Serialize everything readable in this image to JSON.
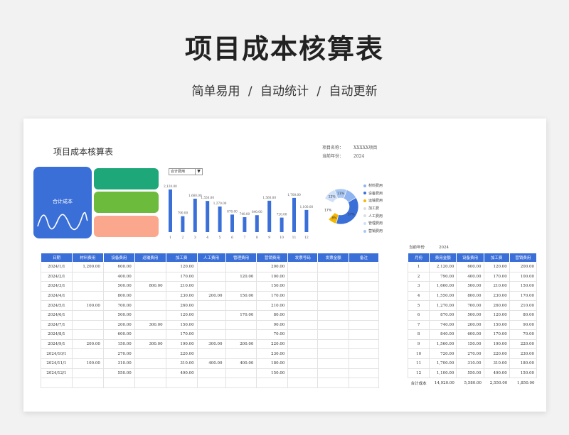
{
  "header": {
    "title": "项目成本核算表",
    "subtitle": "简单易用  /  自动统计  /  自动更新"
  },
  "sheet": {
    "title": "项目成本核算表",
    "project_name_label": "项目名称：",
    "project_name_value": "XXXXX项目",
    "current_year_label": "当前年份：",
    "current_year_value": "2024",
    "card_label": "合计成本",
    "dropdown_value": "合计费用"
  },
  "chart_data": [
    {
      "type": "bar",
      "categories": [
        "1",
        "2",
        "3",
        "4",
        "5",
        "6",
        "7",
        "8",
        "9",
        "10",
        "11",
        "12"
      ],
      "values": [
        2120,
        790,
        1660,
        1550,
        1270,
        870,
        740,
        840,
        1560,
        720,
        1700,
        1100
      ],
      "labels": [
        "2,120.00",
        "790.00",
        "1,660.00",
        "1,550.00",
        "1,270.00",
        "870.00",
        "740.00",
        "840.00",
        "1,560.00",
        "720.00",
        "1,700.00",
        "1,100.00"
      ],
      "color": "#3b6fd8"
    },
    {
      "type": "pie",
      "categories": [
        "材料费用",
        "设备费用",
        "运输费用",
        "加工费",
        "人工费用",
        "管理费用",
        "营销费用"
      ],
      "values": [
        11,
        37,
        8,
        17,
        3,
        12,
        11
      ],
      "labels": [
        "",
        "37%",
        "8%",
        "17%",
        "",
        "12%",
        "11%"
      ],
      "colors": [
        "#8fb4ef",
        "#3b6fd8",
        "#f5b800",
        "#ffffff",
        "#ffffff",
        "#cfe0f8",
        "#a9c7f2"
      ]
    }
  ],
  "cost_table": {
    "headers": [
      "日期",
      "材料费用",
      "设备费用",
      "运输费用",
      "加工费",
      "人工费用",
      "管理费用",
      "营销费用",
      "发票号码",
      "发票金额",
      "备注"
    ],
    "rows": [
      [
        "2024/1/1",
        "1,200.00",
        "600.00",
        "",
        "120.00",
        "",
        "",
        "200.00",
        "",
        "",
        ""
      ],
      [
        "2024/2/1",
        "",
        "400.00",
        "",
        "170.00",
        "",
        "120.00",
        "100.00",
        "",
        "",
        ""
      ],
      [
        "2024/3/1",
        "",
        "500.00",
        "800.00",
        "210.00",
        "",
        "",
        "150.00",
        "",
        "",
        ""
      ],
      [
        "2024/4/1",
        "",
        "800.00",
        "",
        "230.00",
        "200.00",
        "150.00",
        "170.00",
        "",
        "",
        ""
      ],
      [
        "2024/5/1",
        "100.00",
        "700.00",
        "",
        "260.00",
        "",
        "",
        "210.00",
        "",
        "",
        ""
      ],
      [
        "2024/6/1",
        "",
        "500.00",
        "",
        "120.00",
        "",
        "170.00",
        "80.00",
        "",
        "",
        ""
      ],
      [
        "2024/7/1",
        "",
        "200.00",
        "300.00",
        "150.00",
        "",
        "",
        "90.00",
        "",
        "",
        ""
      ],
      [
        "2024/8/1",
        "",
        "600.00",
        "",
        "170.00",
        "",
        "",
        "70.00",
        "",
        "",
        ""
      ],
      [
        "2024/9/1",
        "200.00",
        "150.00",
        "300.00",
        "190.00",
        "300.00",
        "200.00",
        "220.00",
        "",
        "",
        ""
      ],
      [
        "2024/10/1",
        "",
        "270.00",
        "",
        "220.00",
        "",
        "",
        "230.00",
        "",
        "",
        ""
      ],
      [
        "2024/11/1",
        "100.00",
        "310.00",
        "",
        "310.00",
        "400.00",
        "400.00",
        "180.00",
        "",
        "",
        ""
      ],
      [
        "2024/12/1",
        "",
        "550.00",
        "",
        "490.00",
        "",
        "",
        "150.00",
        "",
        "",
        ""
      ],
      [
        "",
        "",
        "",
        "",
        "",
        "",
        "",
        "",
        "",
        "",
        ""
      ]
    ]
  },
  "summary_table": {
    "year_label": "当前年份",
    "year_value": "2024",
    "headers": [
      "月份",
      "费用金额",
      "设备费用",
      "加工费",
      "营销费用"
    ],
    "rows": [
      [
        "1",
        "2,120.00",
        "600.00",
        "120.00",
        "200.00"
      ],
      [
        "2",
        "790.00",
        "400.00",
        "170.00",
        "100.00"
      ],
      [
        "3",
        "1,660.00",
        "500.00",
        "210.00",
        "150.00"
      ],
      [
        "4",
        "1,550.00",
        "800.00",
        "230.00",
        "170.00"
      ],
      [
        "5",
        "1,270.00",
        "700.00",
        "260.00",
        "210.00"
      ],
      [
        "6",
        "870.00",
        "500.00",
        "120.00",
        "80.00"
      ],
      [
        "7",
        "740.00",
        "200.00",
        "150.00",
        "90.00"
      ],
      [
        "8",
        "840.00",
        "600.00",
        "170.00",
        "70.00"
      ],
      [
        "9",
        "1,560.00",
        "150.00",
        "190.00",
        "220.00"
      ],
      [
        "10",
        "720.00",
        "270.00",
        "220.00",
        "230.00"
      ],
      [
        "11",
        "1,700.00",
        "310.00",
        "310.00",
        "180.00"
      ],
      [
        "12",
        "1,100.00",
        "550.00",
        "490.00",
        "150.00"
      ]
    ],
    "total": [
      "合计成本",
      "14,920.00",
      "5,580.00",
      "2,550.00",
      "1,850.00"
    ]
  }
}
